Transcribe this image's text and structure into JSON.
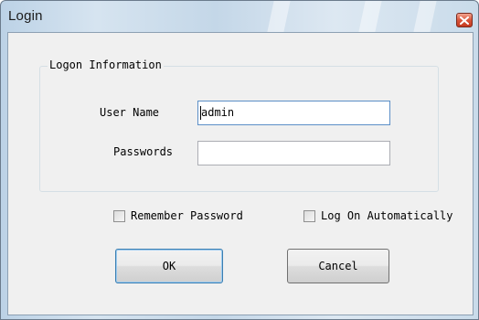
{
  "window": {
    "title": "Login"
  },
  "logon_group": {
    "legend": "Logon Information",
    "username": {
      "label": "User Name",
      "value": "admin"
    },
    "password": {
      "label": "Passwords",
      "value": ""
    }
  },
  "options": {
    "remember_password": {
      "label": "Remember Password",
      "checked": false
    },
    "log_on_automatically": {
      "label": "Log On Automatically",
      "checked": false
    }
  },
  "buttons": {
    "ok": "OK",
    "cancel": "Cancel"
  }
}
